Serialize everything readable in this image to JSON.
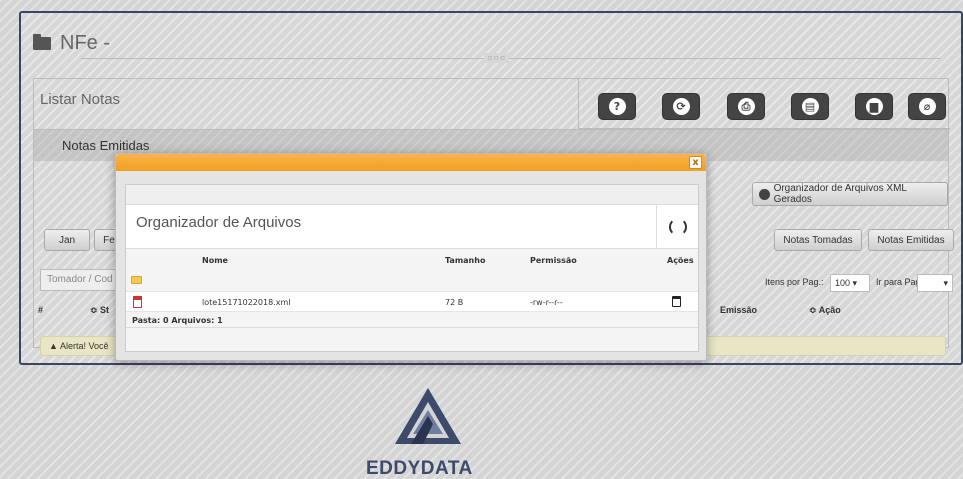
{
  "app": {
    "title": "NFe -",
    "collapse_handle": "▫▫▫"
  },
  "panel": {
    "title": "Listar Notas",
    "toolbar_icons": [
      "help-icon",
      "refresh-icon",
      "print-icon",
      "document-icon",
      "file-icon",
      "attach-icon"
    ],
    "toolbar_glyphs": [
      "?",
      "⟳",
      "⎙",
      "▤",
      "▆",
      "⌀"
    ],
    "section_title": "Notas Emitidas"
  },
  "background_controls": {
    "organizer_button": "Organizador de Arquivos XML Gerados",
    "month_jan": "Jan",
    "month_partial": "Fe",
    "filter_placeholder": "Tomador / Cod",
    "col_hash": "#",
    "col_status": "≎ St",
    "notas_tomadas": "Notas Tomadas",
    "notas_emitidas": "Notas Emitidas",
    "itens_label": "Itens por Pag.:",
    "itens_value": "100",
    "ir_label": "Ir para Pag.:",
    "col_emissao": "Emissão",
    "col_acao": "≎ Ação",
    "alert_text": "Alerta! Você"
  },
  "modal": {
    "close_glyph": "x",
    "title": "Organizador de Arquivos",
    "columns": {
      "name": "Nome",
      "size": "Tamanho",
      "permission": "Permissão",
      "actions": "Ações"
    },
    "files": [
      {
        "name": "lote15171022018.xml",
        "size": "72 B",
        "permission": "-rw-r--r--"
      }
    ],
    "footer": "Pasta: 0 Arquivos: 1"
  },
  "brand": {
    "name": "EDDYDATA"
  },
  "colors": {
    "accent": "#f09f22",
    "panel_border": "#3a4560",
    "brand": "#3d4a6b"
  }
}
